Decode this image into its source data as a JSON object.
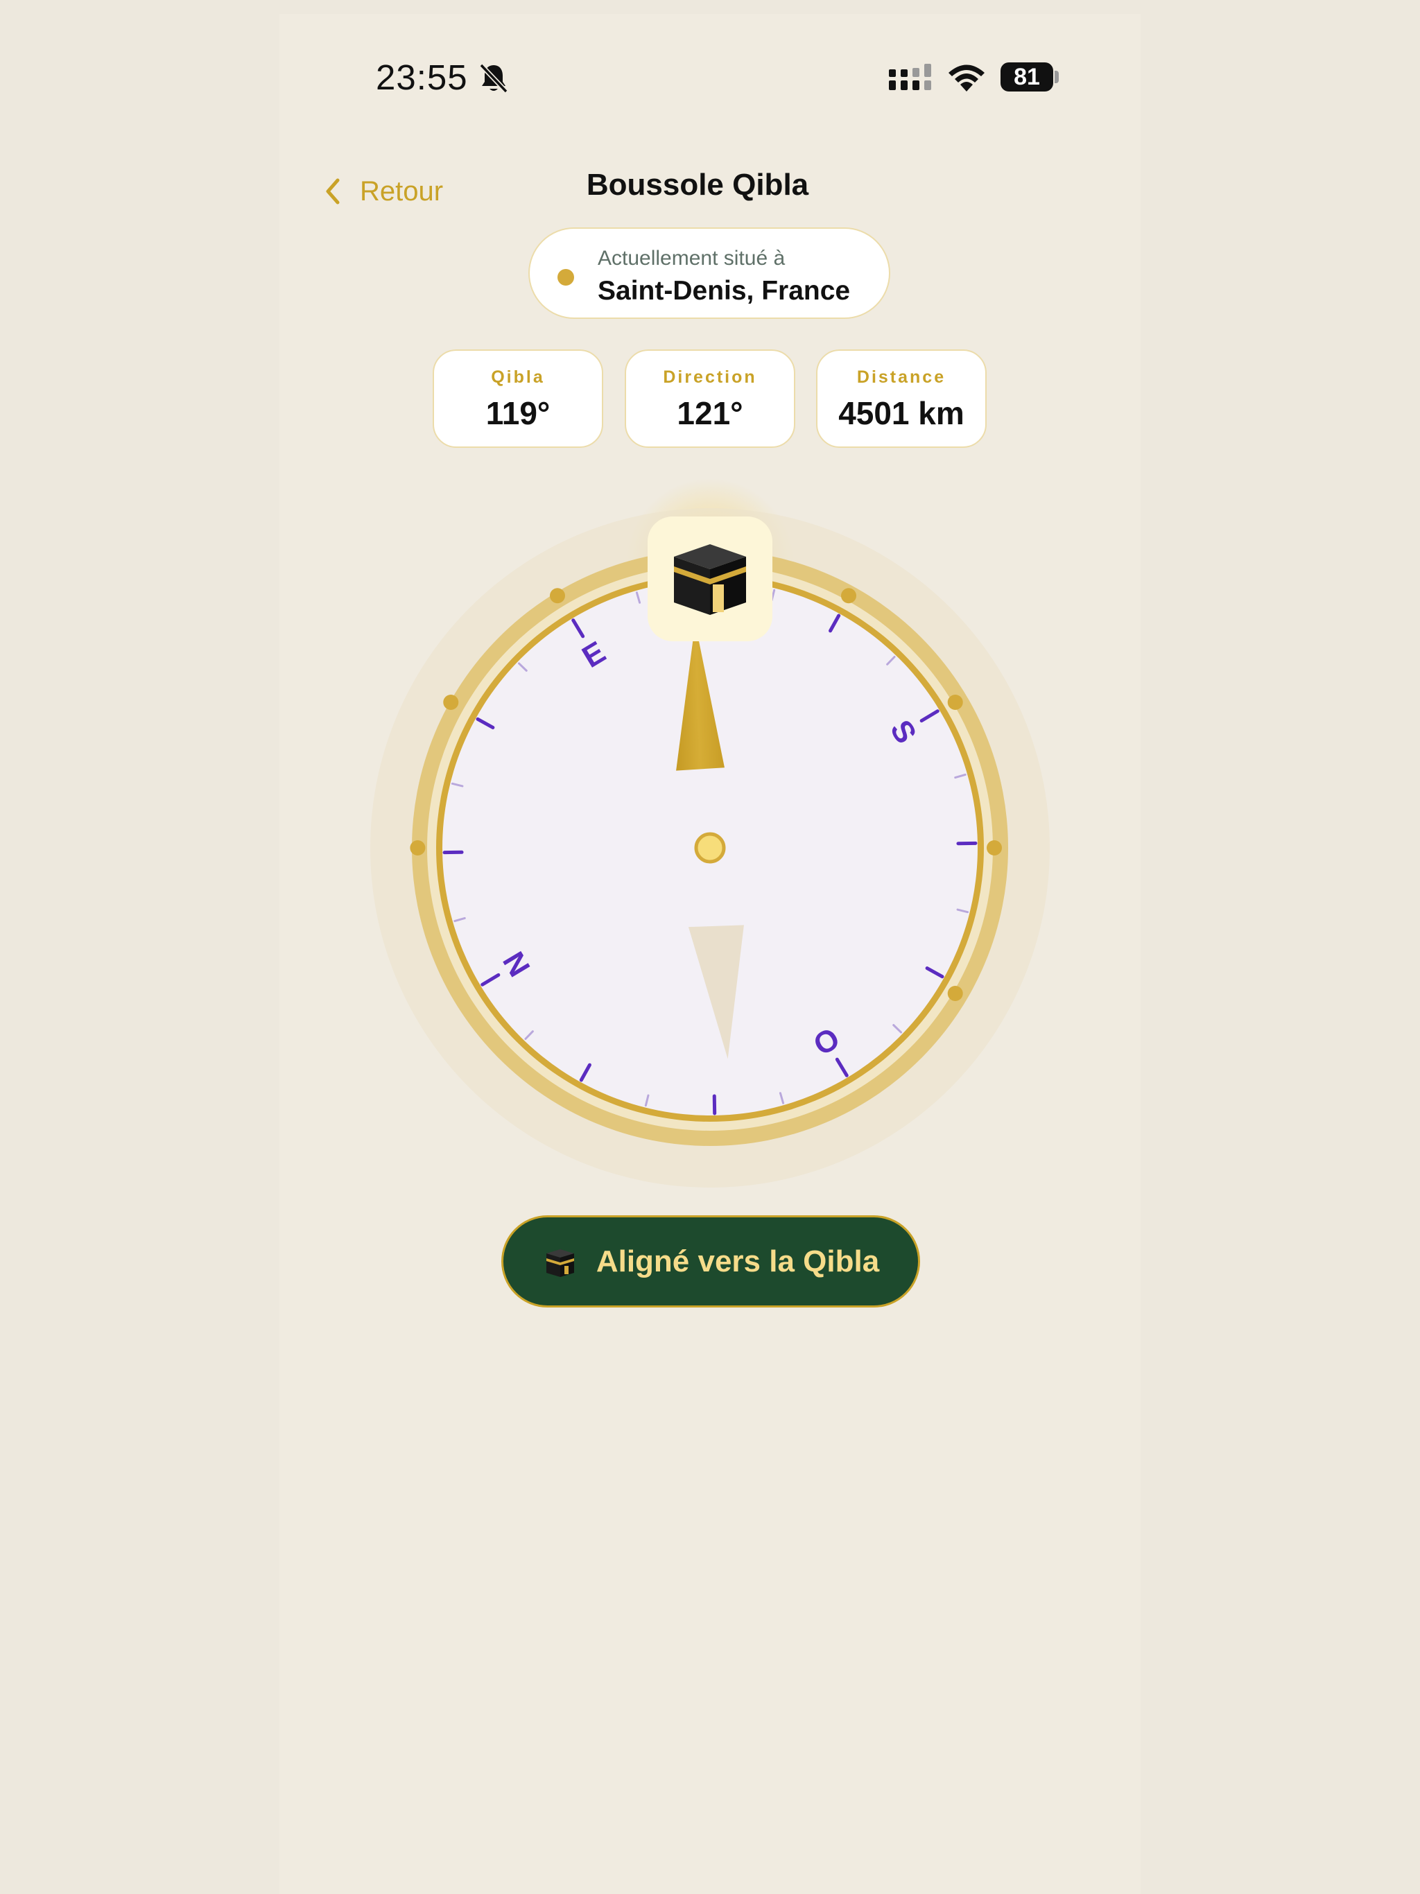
{
  "status_bar": {
    "time": "23:55",
    "battery": "81"
  },
  "nav": {
    "back_label": "Retour",
    "title": "Boussole Qibla"
  },
  "location": {
    "subtitle": "Actuellement situé à",
    "city": "Saint-Denis, France"
  },
  "stats": [
    {
      "label": "Qibla",
      "value": "119°"
    },
    {
      "label": "Direction",
      "value": "121°"
    },
    {
      "label": "Distance",
      "value": "4501 km"
    }
  ],
  "compass": {
    "heading_deg": 121,
    "qibla_deg": 119,
    "cardinals": [
      {
        "letter": "N",
        "deg": 0
      },
      {
        "letter": "E",
        "deg": 90
      },
      {
        "letter": "S",
        "deg": 180
      },
      {
        "letter": "O",
        "deg": 270
      }
    ],
    "accent": "#d4aa3a",
    "cardinal_color": "#5b2cc0"
  },
  "status_button": {
    "label": "Aligné vers la Qibla",
    "icon": "kaaba-icon"
  },
  "colors": {
    "background": "#f0ebe0",
    "gold": "#c9a227",
    "dark_green": "#1d4a2d"
  }
}
